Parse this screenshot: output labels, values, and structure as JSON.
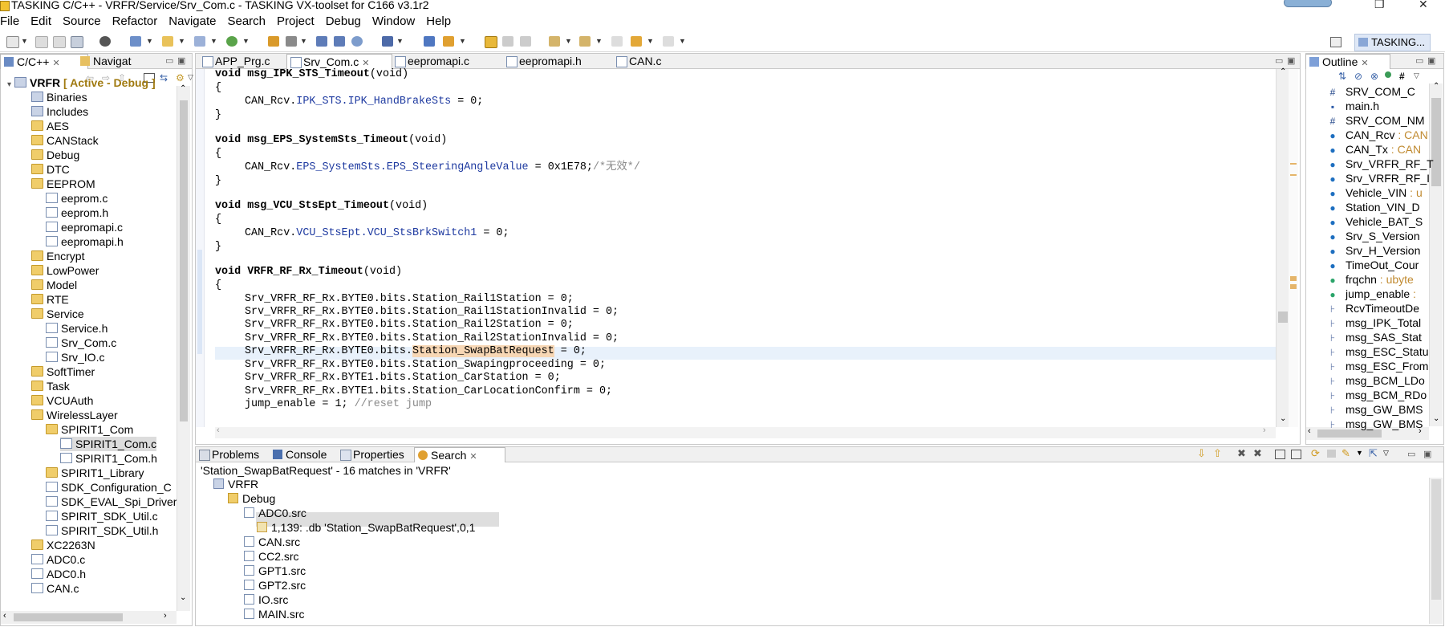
{
  "window": {
    "title": "TASKING C/C++ - VRFR/Service/Srv_Com.c - TASKING VX-toolset for C166 v3.1r2",
    "restore_glyph": "❐",
    "close_glyph": "✕"
  },
  "menu": [
    "File",
    "Edit",
    "Source",
    "Refactor",
    "Navigate",
    "Search",
    "Project",
    "Debug",
    "Window",
    "Help"
  ],
  "perspective": {
    "label": "TASKING..."
  },
  "explorer": {
    "tabs": [
      {
        "label": "C/C++",
        "close": "✕"
      },
      {
        "label": "Navigat"
      }
    ],
    "project": {
      "name": "VRFR",
      "status": "[ Active - Debug ]"
    },
    "items": [
      {
        "label": "Binaries",
        "icon": "binaries-icon"
      },
      {
        "label": "Includes",
        "icon": "includes-icon"
      },
      {
        "label": "AES",
        "icon": "folder-icon"
      },
      {
        "label": "CANStack",
        "icon": "folder-icon"
      },
      {
        "label": "Debug",
        "icon": "folder-icon"
      },
      {
        "label": "DTC",
        "icon": "folder-icon"
      },
      {
        "label": "EEPROM",
        "icon": "folder-icon"
      },
      {
        "label": "eeprom.c",
        "icon": "c-file-icon"
      },
      {
        "label": "eeprom.h",
        "icon": "h-file-icon"
      },
      {
        "label": "eepromapi.c",
        "icon": "c-file-icon"
      },
      {
        "label": "eepromapi.h",
        "icon": "h-file-icon"
      },
      {
        "label": "Encrypt",
        "icon": "folder-icon"
      },
      {
        "label": "LowPower",
        "icon": "folder-icon"
      },
      {
        "label": "Model",
        "icon": "folder-icon"
      },
      {
        "label": "RTE",
        "icon": "folder-icon"
      },
      {
        "label": "Service",
        "icon": "folder-icon"
      },
      {
        "label": "Service.h",
        "icon": "h-file-icon"
      },
      {
        "label": "Srv_Com.c",
        "icon": "c-file-icon"
      },
      {
        "label": "Srv_IO.c",
        "icon": "c-file-icon"
      },
      {
        "label": "SoftTimer",
        "icon": "folder-icon"
      },
      {
        "label": "Task",
        "icon": "folder-icon"
      },
      {
        "label": "VCUAuth",
        "icon": "folder-icon"
      },
      {
        "label": "WirelessLayer",
        "icon": "folder-icon"
      },
      {
        "label": "SPIRIT1_Com",
        "icon": "folder-icon"
      },
      {
        "label": "SPIRIT1_Com.c",
        "icon": "c-file-icon"
      },
      {
        "label": "SPIRIT1_Com.h",
        "icon": "h-file-icon"
      },
      {
        "label": "SPIRIT1_Library",
        "icon": "folder-icon"
      },
      {
        "label": "SDK_Configuration_C",
        "icon": "h-file-icon"
      },
      {
        "label": "SDK_EVAL_Spi_Driver",
        "icon": "h-file-icon"
      },
      {
        "label": "SPIRIT_SDK_Util.c",
        "icon": "c-file-icon"
      },
      {
        "label": "SPIRIT_SDK_Util.h",
        "icon": "h-file-icon"
      },
      {
        "label": "XC2263N",
        "icon": "folder-icon"
      },
      {
        "label": "ADC0.c",
        "icon": "c-file-icon"
      },
      {
        "label": "ADC0.h",
        "icon": "h-file-icon"
      },
      {
        "label": "CAN.c",
        "icon": "c-file-icon"
      }
    ]
  },
  "editor": {
    "tabs": [
      {
        "label": "APP_Prg.c"
      },
      {
        "label": "Srv_Com.c",
        "close": "✕"
      },
      {
        "label": "eepromapi.c"
      },
      {
        "label": "eepromapi.h"
      },
      {
        "label": "CAN.c"
      }
    ],
    "code": {
      "l1_kw": "void",
      "l1_fn": "msg_IPK_STS_Timeout",
      "l1_par": "(void)",
      "l2": "{",
      "l3_a": "CAN_Rcv.",
      "l3_b": "IPK_STS.IPK_HandBrakeSts",
      "l3_c": " = 0;",
      "l4": "}",
      "l5_kw": "void",
      "l5_fn": "msg_EPS_SystemSts_Timeout",
      "l5_par": "(void)",
      "l6": "{",
      "l7_a": "CAN_Rcv.",
      "l7_b": "EPS_SystemSts.EPS_SteeringAngleValue",
      "l7_c": " = 0x1E78;",
      "l7_cm": "/*无效*/",
      "l8": "}",
      "l9_kw": "void",
      "l9_fn": "msg_VCU_StsEpt_Timeout",
      "l9_par": "(void)",
      "l10": "{",
      "l11_a": "CAN_Rcv.",
      "l11_b": "VCU_StsEpt.VCU_StsBrkSwitch1",
      "l11_c": " = 0;",
      "l12": "}",
      "l13_kw": "void",
      "l13_fn": "VRFR_RF_Rx_Timeout",
      "l13_par": "(void)",
      "l14": "{",
      "l15": "Srv_VRFR_RF_Rx.BYTE0.bits.Station_Rail1Station = 0;",
      "l16": "Srv_VRFR_RF_Rx.BYTE0.bits.Station_Rail1StationInvalid = 0;",
      "l17": "Srv_VRFR_RF_Rx.BYTE0.bits.Station_Rail2Station = 0;",
      "l18": "Srv_VRFR_RF_Rx.BYTE0.bits.Station_Rail2StationInvalid = 0;",
      "l19_a": "Srv_VRFR_RF_Rx.BYTE0.bits.",
      "l19_hl": "Station_SwapBatRequest",
      "l19_c": " = 0;",
      "l20": "Srv_VRFR_RF_Rx.BYTE0.bits.Station_Swapingproceeding = 0;",
      "l21": "Srv_VRFR_RF_Rx.BYTE1.bits.Station_CarStation = 0;",
      "l22": "Srv_VRFR_RF_Rx.BYTE1.bits.Station_CarLocationConfirm = 0;",
      "l23_a": "jump_enable = 1; ",
      "l23_cm": "//reset jump"
    }
  },
  "outline": {
    "tab": {
      "label": "Outline",
      "close": "✕"
    },
    "items": [
      {
        "glyph": "#",
        "label": "SRV_COM_C",
        "suffix": ""
      },
      {
        "glyph": "▪",
        "label": "main.h",
        "suffix": ""
      },
      {
        "glyph": "#",
        "label": "SRV_COM_NM",
        "suffix": ""
      },
      {
        "glyph": "●",
        "label": "CAN_Rcv",
        "suffix": " : CAN"
      },
      {
        "glyph": "●",
        "label": "CAN_Tx",
        "suffix": " : CAN"
      },
      {
        "glyph": "●",
        "label": "Srv_VRFR_RF_T",
        "suffix": ""
      },
      {
        "glyph": "●",
        "label": "Srv_VRFR_RF_I",
        "suffix": ""
      },
      {
        "glyph": "●",
        "label": "Vehicle_VIN",
        "suffix": " : u"
      },
      {
        "glyph": "●",
        "label": "Station_VIN_D",
        "suffix": ""
      },
      {
        "glyph": "●",
        "label": "Vehicle_BAT_S",
        "suffix": ""
      },
      {
        "glyph": "●",
        "label": "Srv_S_Version",
        "suffix": ""
      },
      {
        "glyph": "●",
        "label": "Srv_H_Version",
        "suffix": ""
      },
      {
        "glyph": "●",
        "label": "TimeOut_Cour",
        "suffix": ""
      },
      {
        "glyph": "●",
        "label": "frqchn",
        "suffix": " : ubyte"
      },
      {
        "glyph": "●",
        "label": "jump_enable",
        "suffix": " :"
      },
      {
        "glyph": "⊦",
        "label": "RcvTimeoutDe",
        "suffix": ""
      },
      {
        "glyph": "⊦",
        "label": "msg_IPK_Total",
        "suffix": ""
      },
      {
        "glyph": "⊦",
        "label": "msg_SAS_Stat",
        "suffix": ""
      },
      {
        "glyph": "⊦",
        "label": "msg_ESC_Statu",
        "suffix": ""
      },
      {
        "glyph": "⊦",
        "label": "msg_ESC_From",
        "suffix": ""
      },
      {
        "glyph": "⊦",
        "label": "msg_BCM_LDo",
        "suffix": ""
      },
      {
        "glyph": "⊦",
        "label": "msg_BCM_RDo",
        "suffix": ""
      },
      {
        "glyph": "⊦",
        "label": "msg_GW_BMS",
        "suffix": ""
      },
      {
        "glyph": "⊦",
        "label": "msg_GW_BMS",
        "suffix": ""
      }
    ]
  },
  "bottom": {
    "tabs": [
      {
        "label": "Problems"
      },
      {
        "label": "Console"
      },
      {
        "label": "Properties"
      },
      {
        "label": "Search",
        "close": "✕"
      }
    ],
    "summary": "'Station_SwapBatRequest' - 16 matches in 'VRFR'",
    "results": [
      {
        "label": "VRFR",
        "depth": 0
      },
      {
        "label": "Debug",
        "depth": 1
      },
      {
        "label": "ADC0.src",
        "depth": 2
      },
      {
        "label": "1,139: .db 'Station_SwapBatRequest',0,1",
        "depth": 3
      },
      {
        "label": "CAN.src",
        "depth": 2
      },
      {
        "label": "CC2.src",
        "depth": 2
      },
      {
        "label": "GPT1.src",
        "depth": 2
      },
      {
        "label": "GPT2.src",
        "depth": 2
      },
      {
        "label": "IO.src",
        "depth": 2
      },
      {
        "label": "MAIN.src",
        "depth": 2
      }
    ]
  }
}
